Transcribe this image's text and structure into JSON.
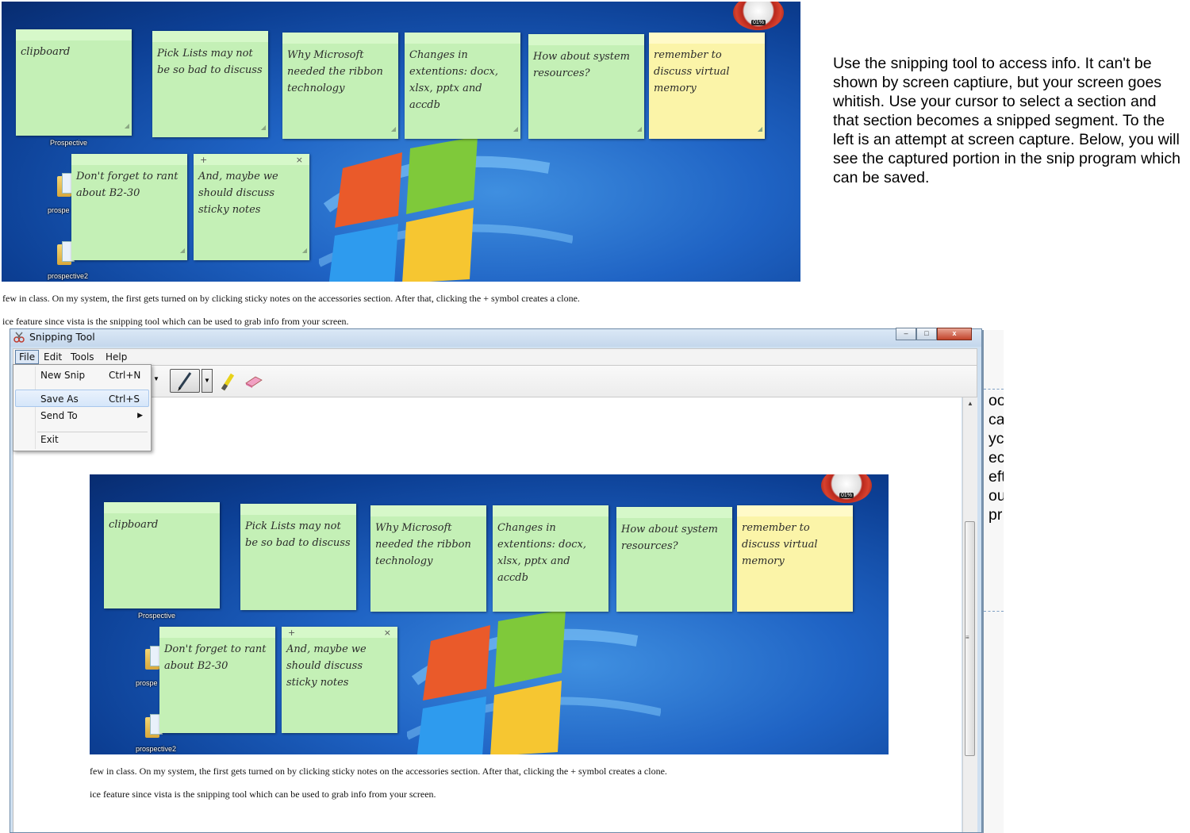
{
  "top_capture": {
    "notes": [
      {
        "text": "clipboard",
        "color": "green"
      },
      {
        "text": "Pick Lists may not be so bad to discuss",
        "color": "green"
      },
      {
        "text": "Why Microsoft needed the ribbon technology",
        "color": "green"
      },
      {
        "text": "Changes in extentions: docx, xlsx, pptx and accdb",
        "color": "green"
      },
      {
        "text": "How about system resources?",
        "color": "green"
      },
      {
        "text": "remember to discuss virtual memory",
        "color": "yellow"
      },
      {
        "text": "Don't forget to rant about B2-30",
        "color": "green"
      },
      {
        "text": "And, maybe we should discuss sticky notes",
        "color": "green",
        "active": true
      }
    ],
    "note_controls": {
      "plus": "+",
      "close": "×"
    },
    "desktop_labels": {
      "prospective": "Prospective",
      "prospe": "prospe",
      "prospective2": "prospective2"
    },
    "gadget_pct": "01%",
    "doc_lines": [
      "few in class. On my system, the first gets turned on by clicking sticky notes on the accessories section. After that, clicking the + symbol creates a clone.",
      "ice feature since vista is the snipping tool which can be used to grab info from your screen."
    ]
  },
  "instructions": "Use the snipping tool to access info. It can't be shown by screen captiure, but your screen goes whitish. Use your cursor to select a section and that section becomes a snipped segment. To the left is an attempt at screen capture. Below, you will see the captured portion in the snip program which can be saved.",
  "snipping_tool": {
    "title": "Snipping Tool",
    "window_buttons": {
      "minimize": "–",
      "maximize": "□",
      "close": "x"
    },
    "menu": [
      "File",
      "Edit",
      "Tools",
      "Help"
    ],
    "file_menu": [
      {
        "label": "New Snip",
        "shortcut": "Ctrl+N"
      },
      {
        "label": "Save As",
        "shortcut": "Ctrl+S",
        "highlighted": true
      },
      {
        "label": "Send To",
        "submenu": "▶"
      },
      {
        "label": "Exit"
      }
    ]
  },
  "behind_fragments": [
    "oo",
    "ca",
    "yc",
    "ec",
    "eft",
    "ou",
    "pr"
  ],
  "colors": {
    "note_green": "#c4f0b6",
    "note_yellow": "#fbf4a8",
    "desktop_blue": "#1f63c4",
    "menu_highlight": "#d5e6fa"
  }
}
